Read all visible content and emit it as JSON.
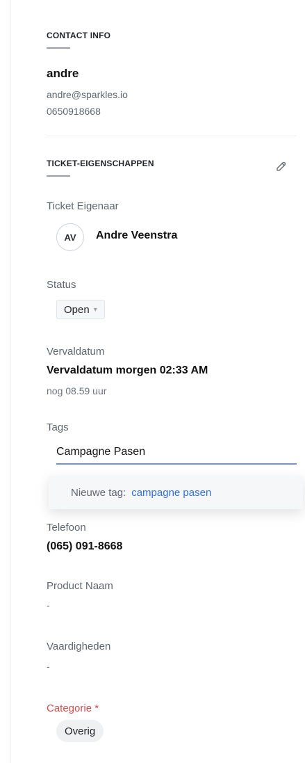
{
  "contact": {
    "section_title": "CONTACT INFO",
    "name": "andre",
    "email": "andre@sparkles.io",
    "phone": "0650918668"
  },
  "ticket": {
    "section_title": "TICKET-EIGENSCHAPPEN",
    "owner": {
      "label": "Ticket Eigenaar",
      "initials": "AV",
      "name": "Andre Veenstra"
    },
    "status": {
      "label": "Status",
      "value": "Open",
      "chevron": "▾"
    },
    "due": {
      "label": "Vervaldatum",
      "value": "Vervaldatum morgen 02:33 AM",
      "remaining": "nog 08.59 uur"
    },
    "tags": {
      "label": "Tags",
      "input_value": "Campagne Pasen",
      "dropdown_prefix": "Nieuwe tag:",
      "dropdown_suggestion": "campagne pasen"
    },
    "telefoon": {
      "label": "Telefoon",
      "value": "(065) 091-8668"
    },
    "product": {
      "label": "Product Naam",
      "value": "-"
    },
    "vaardigheden": {
      "label": "Vaardigheden",
      "value": "-"
    },
    "categorie": {
      "label": "Categorie *",
      "value": "Overig"
    }
  },
  "colors": {
    "accent": "#2f6fd8",
    "required": "#d74c4c",
    "underline": "#9aa0a8"
  },
  "icons": {
    "edit": "pencil-icon",
    "status_chevron": "chevron-down-icon"
  }
}
